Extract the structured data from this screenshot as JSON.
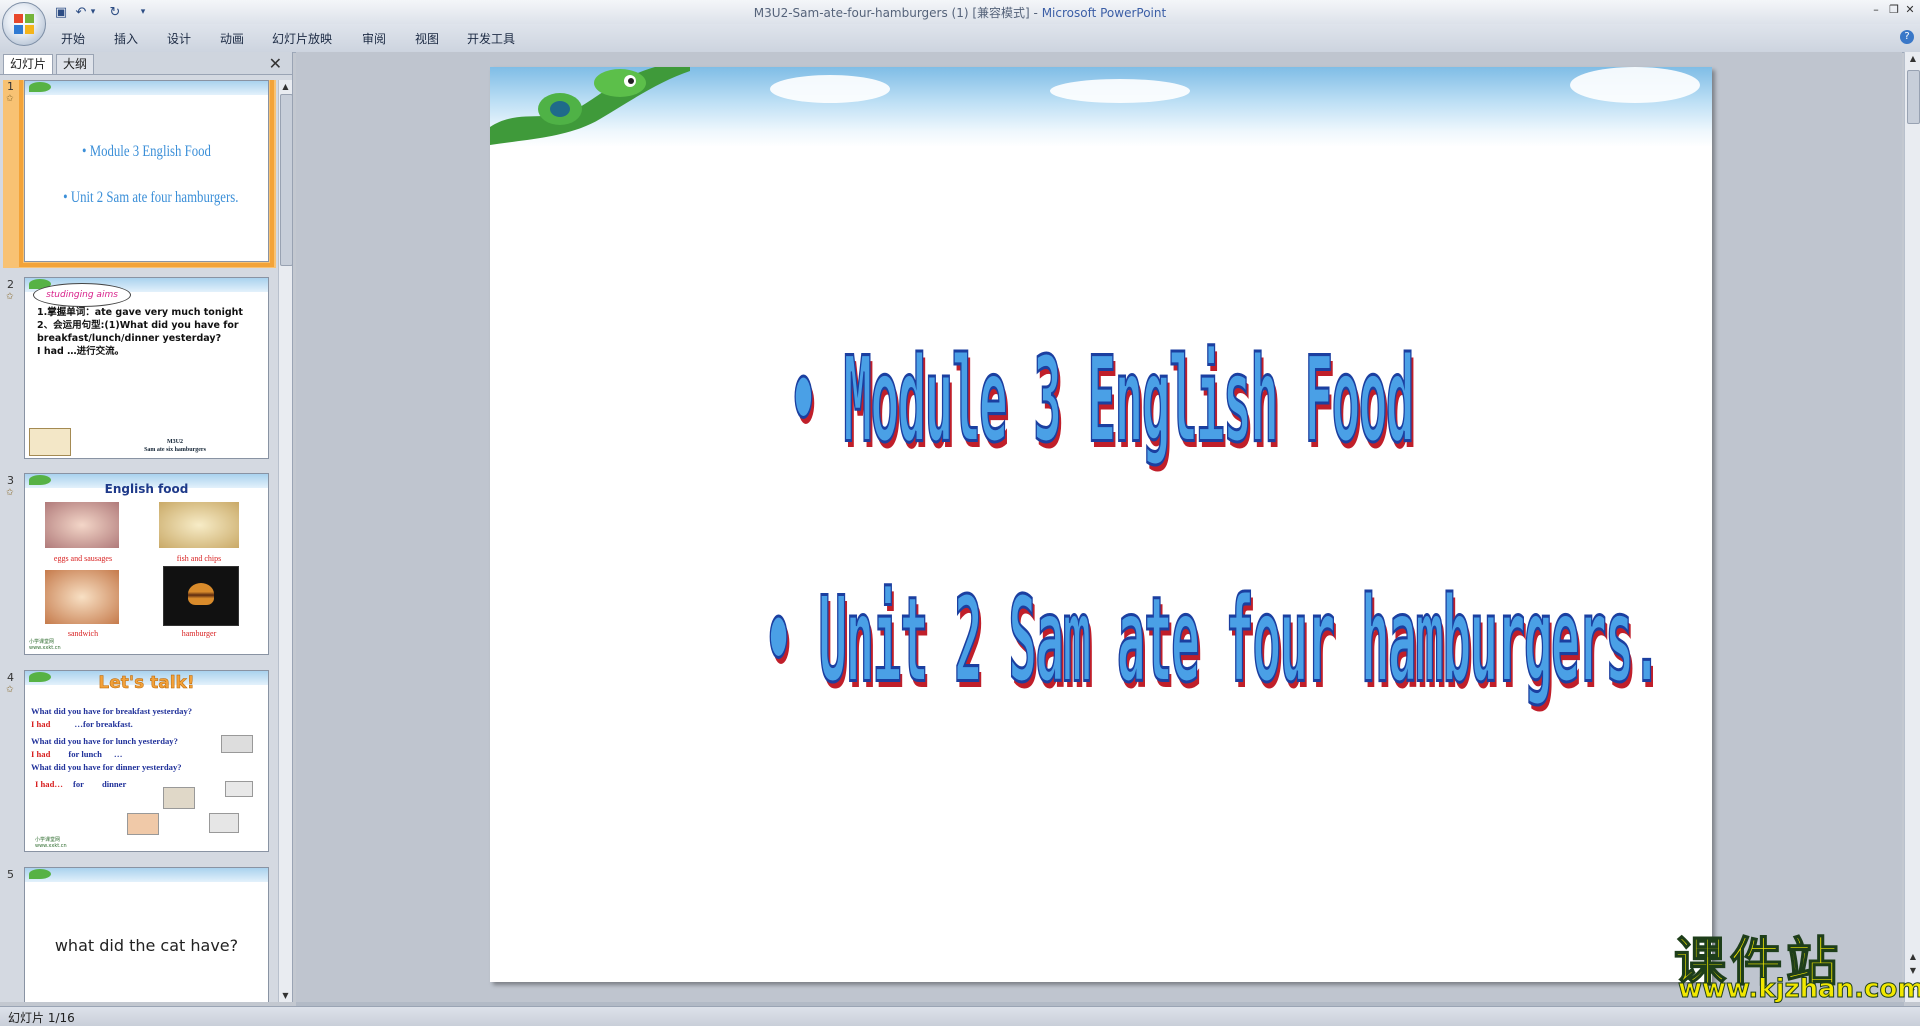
{
  "window": {
    "title": "M3U2-Sam-ate-four-hamburgers (1) [兼容模式] - ",
    "app_name": "Microsoft PowerPoint",
    "minimize": "–",
    "restore": "❐",
    "close": "✕"
  },
  "quick_access": {
    "save": "▣",
    "undo": "↶",
    "undo_dropdown": "▾",
    "redo": "↻",
    "customize": "▾"
  },
  "ribbon": {
    "tabs": [
      "开始",
      "插入",
      "设计",
      "动画",
      "幻灯片放映",
      "审阅",
      "视图",
      "开发工具"
    ],
    "help": "?"
  },
  "panel": {
    "tab_slides": "幻灯片",
    "tab_outline": "大纲",
    "close": "✕"
  },
  "thumbnails": [
    {
      "num": "1",
      "lines": [
        "• Module 3 English Food",
        "• Unit 2  Sam ate four hamburgers."
      ]
    },
    {
      "num": "2",
      "cloud": "studinging aims",
      "lines": [
        "1.掌握单词：ate gave very much tonight",
        "2、会运用句型:(1)What did you have for",
        "breakfast/lunch/dinner yesterday?",
        "I had …进行交流。"
      ],
      "footer1": "M3U2",
      "footer2": "Sam ate six hamburgers"
    },
    {
      "num": "3",
      "title": "English food",
      "captions": [
        "eggs and sausages",
        "fish and chips",
        "sandwich",
        "hamburger"
      ],
      "logo": "小学课堂网",
      "logo_url": "www.xxkt.cn"
    },
    {
      "num": "4",
      "title": "Let's talk!",
      "q1": "What did you have for breakfast yesterday?",
      "a1": "I had",
      "a1b": "…for breakfast.",
      "q2": "What did you have for lunch yesterday?",
      "a2": "I had",
      "a2b": "for lunch",
      "a2c": "…",
      "q3": "What did you have for dinner yesterday?",
      "a3": "I had…",
      "a3b": "for",
      "a3c": "dinner",
      "logo": "小学课堂网",
      "logo_url": "www.xxkt.cn"
    },
    {
      "num": "5",
      "text": "what did the cat have?"
    }
  ],
  "slide": {
    "line1": "• Module 3 English Food",
    "line2": "• Unit 2  Sam ate four hamburgers."
  },
  "watermark": {
    "cn": "课件站",
    "url": "www.kjzhan.com"
  },
  "status": {
    "text": "幻灯片 1/16"
  }
}
